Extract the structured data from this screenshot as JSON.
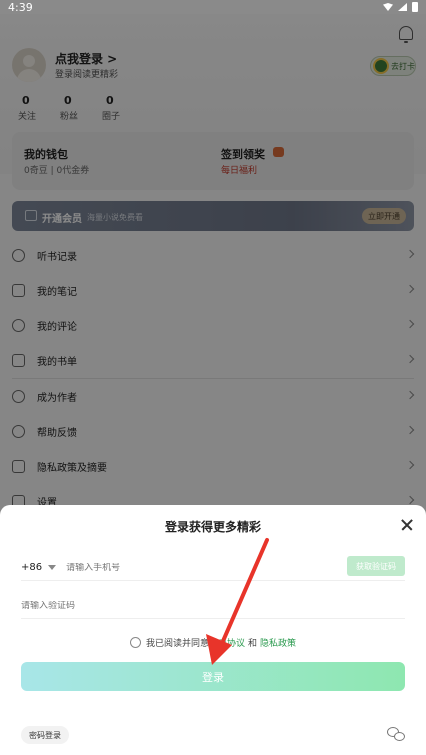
{
  "status_bar": {
    "time": "4:39"
  },
  "profile": {
    "login_title": "点我登录 >",
    "login_subtitle": "登录阅读更精彩",
    "badge_label": "去打卡"
  },
  "stats": [
    {
      "value": "0",
      "label": "关注"
    },
    {
      "value": "0",
      "label": "粉丝"
    },
    {
      "value": "0",
      "label": "圈子"
    }
  ],
  "wallet": {
    "title": "我的钱包",
    "subtitle": "0奇豆 | 0代金券",
    "checkin_title": "签到领奖",
    "checkin_subtitle": "每日福利"
  },
  "vip": {
    "title": "开通会员",
    "subtitle": "海量小说免费看",
    "button": "立即开通"
  },
  "menu": {
    "group1": [
      "听书记录",
      "我的笔记",
      "我的评论",
      "我的书单"
    ],
    "group2": [
      "成为作者",
      "帮助反馈",
      "隐私政策及摘要",
      "设置"
    ]
  },
  "sheet": {
    "title": "登录获得更多精彩",
    "country_code": "+86",
    "phone_placeholder": "请输入手机号",
    "get_code": "获取验证码",
    "code_placeholder": "请输入验证码",
    "agree_prefix": "我已阅读并同意",
    "user_agreement": "用户协议",
    "and": "和",
    "privacy_policy": "隐私政策",
    "login_button": "登录",
    "password_login": "密码登录"
  },
  "colors": {
    "accent_green": "#2a9a4e",
    "login_gradient_start": "#a8e6e8",
    "login_gradient_end": "#8ee7b0",
    "arrow_red": "#e8342a"
  }
}
